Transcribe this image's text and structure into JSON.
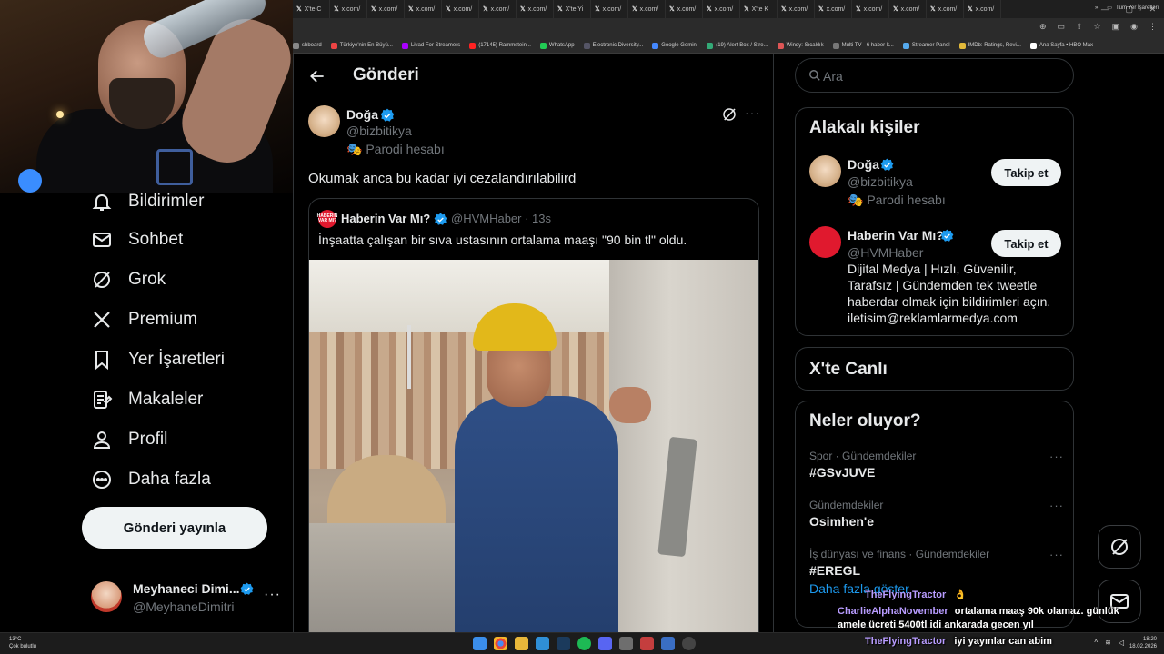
{
  "browser": {
    "tabs": [
      "X'te C",
      "x.com/",
      "x.com/",
      "x.com/",
      "x.com/",
      "x.com/",
      "x.com/",
      "X'te Yi",
      "x.com/",
      "x.com/",
      "x.com/",
      "x.com/",
      "X'te K",
      "x.com/",
      "x.com/",
      "x.com/",
      "x.com/",
      "x.com/",
      "x.com/"
    ],
    "bookmarks": [
      "shboard",
      "Türkiye'nin En Büyü...",
      "Livad For Streamers",
      "(17145) Rammstein...",
      "WhatsApp",
      "Electronic Diversity...",
      "Google Gemini",
      "(19) Alert Box / Stre...",
      "Windy: Sıcaklık",
      "Multi TV - 6 haber k...",
      "Streamer Panel",
      "IMDb: Ratings, Revi...",
      "Ana Sayfa • HBO Max"
    ],
    "all_bookmarks_label": "Tüm Yer İşaretleri",
    "more_bookmarks": "»"
  },
  "nav": {
    "items": [
      {
        "label": "Bildirimler",
        "icon": "bell-icon"
      },
      {
        "label": "Sohbet",
        "icon": "mail-icon"
      },
      {
        "label": "Grok",
        "icon": "grok-icon"
      },
      {
        "label": "Premium",
        "icon": "x-logo-icon"
      },
      {
        "label": "Yer İşaretleri",
        "icon": "bookmark-icon"
      },
      {
        "label": "Makaleler",
        "icon": "article-icon"
      },
      {
        "label": "Profil",
        "icon": "person-icon"
      },
      {
        "label": "Daha fazla",
        "icon": "more-circle-icon"
      }
    ],
    "post_button": "Gönderi yayınla",
    "account": {
      "name": "Meyhaneci Dimi...",
      "handle": "@MeyhaneDimitri",
      "more": "···"
    }
  },
  "main": {
    "title": "Gönderi",
    "author": {
      "name": "Doğa",
      "handle": "@bizbitikya",
      "parody": "🎭 Parodi hesabı"
    },
    "text": "Okumak anca bu kadar iyi cezalandırılabilird",
    "quote": {
      "avatar_text": "HABERİN VAR MI?",
      "name": "Haberin Var Mı?",
      "handle": "@HVMHaber · 13s",
      "text": "İnşaatta çalışan bir sıva ustasının ortalama maaşı \"90 bin tl\" oldu."
    }
  },
  "sidebar": {
    "search_placeholder": "Ara",
    "related_title": "Alakalı kişiler",
    "people": [
      {
        "name": "Doğa",
        "handle": "@bizbitikya",
        "extra": "🎭 Parodi hesabı",
        "follow": "Takip et"
      },
      {
        "name": "Haberin Var Mı?",
        "handle": "@HVMHaber",
        "bio": "Dijital Medya | Hızlı, Güvenilir, Tarafsız | Gündemden tek tweetle haberdar olmak için bildirimleri açın. iletisim@reklamlarmedya.com",
        "follow": "Takip et"
      }
    ],
    "live_title": "X'te Canlı",
    "trends_title": "Neler oluyor?",
    "trends": [
      {
        "category": "Spor · Gündemdekiler",
        "topic": "#GSvJUVE"
      },
      {
        "category": "Gündemdekiler",
        "topic": "Osimhen'e"
      },
      {
        "category": "İş dünyası ve finans · Gündemdekiler",
        "topic": "#EREGL"
      }
    ],
    "show_more": "Daha fazla göster"
  },
  "chat": [
    {
      "user": "TheFlyingTractor",
      "msg": "👌"
    },
    {
      "user": "CharlieAlphaNovember",
      "msg": "ortalama maaş 90k olamaz. günlük amele ücreti 5400tl idi ankarada gecen yıl"
    },
    {
      "user": "TheFlyingTractor",
      "msg": "iyi yayınlar can abim"
    }
  ],
  "taskbar": {
    "weather_temp": "13°C",
    "weather_desc": "Çok bulutlu",
    "time": "18:20",
    "date": "18.02.2026"
  },
  "colors": {
    "accent": "#1d9bf0",
    "background": "#000000",
    "border": "#2f3336",
    "muted": "#71767b",
    "chat_user": "#b89cff"
  }
}
